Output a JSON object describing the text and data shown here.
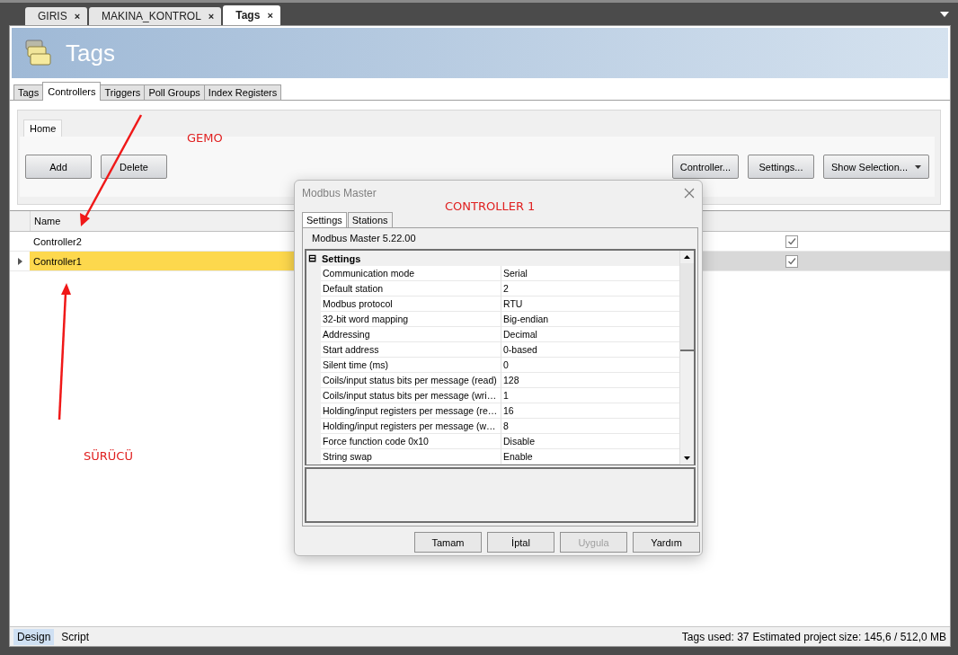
{
  "document_tabs": [
    {
      "label": "GIRIS",
      "selected": false,
      "close": "×"
    },
    {
      "label": "MAKINA_KONTROL",
      "selected": false,
      "close": "×"
    },
    {
      "label": "Tags",
      "selected": true,
      "close": "×"
    }
  ],
  "header": {
    "title": "Tags"
  },
  "tabs": [
    {
      "label": "Tags",
      "selected": false
    },
    {
      "label": "Controllers",
      "selected": true
    },
    {
      "label": "Triggers",
      "selected": false
    },
    {
      "label": "Poll Groups",
      "selected": false
    },
    {
      "label": "Index Registers",
      "selected": false
    }
  ],
  "ribbon": {
    "tab": "Home",
    "left_buttons": [
      "Add",
      "Delete"
    ],
    "right_buttons": [
      {
        "label": "Controller...",
        "kind": "plain"
      },
      {
        "label": "Settings...",
        "kind": "plain"
      },
      {
        "label": "Show Selection...",
        "kind": "dropdown"
      }
    ]
  },
  "grid": {
    "columns": [
      "Name"
    ],
    "rows": [
      {
        "name": "Controller2",
        "checked": true,
        "selected": false
      },
      {
        "name": "Controller1",
        "checked": true,
        "selected": true
      }
    ]
  },
  "status_bar": {
    "views": [
      {
        "label": "Design",
        "selected": true
      },
      {
        "label": "Script",
        "selected": false
      }
    ],
    "tags_used": "Tags used: 37",
    "project_size": "Estimated project size: 145,6 / 512,0 MB"
  },
  "dialog": {
    "title": "Modbus Master",
    "tabs": [
      {
        "label": "Settings",
        "selected": true
      },
      {
        "label": "Stations",
        "selected": false
      }
    ],
    "version": "Modbus Master 5.22.00",
    "category": {
      "label": "Settings",
      "expanded": true,
      "toggle": "⊟"
    },
    "properties": [
      {
        "name": "Communication mode",
        "value": "Serial"
      },
      {
        "name": "Default station",
        "value": "2"
      },
      {
        "name": "Modbus protocol",
        "value": "RTU"
      },
      {
        "name": "32-bit word mapping",
        "value": "Big-endian"
      },
      {
        "name": "Addressing",
        "value": "Decimal"
      },
      {
        "name": "Start address",
        "value": "0-based"
      },
      {
        "name": "Silent time (ms)",
        "value": "0"
      },
      {
        "name": "Coils/input status bits per message (read)",
        "value": "128"
      },
      {
        "name": "Coils/input status bits per message (wri…",
        "value": "1"
      },
      {
        "name": "Holding/input registers per message (re…",
        "value": "16"
      },
      {
        "name": "Holding/input registers per message (w…",
        "value": "8"
      },
      {
        "name": "Force function code 0x10",
        "value": "Disable"
      },
      {
        "name": "String swap",
        "value": "Enable"
      }
    ],
    "buttons": [
      {
        "label": "Tamam",
        "disabled": false
      },
      {
        "label": "İptal",
        "disabled": false
      },
      {
        "label": "Uygula",
        "disabled": true
      },
      {
        "label": "Yardım",
        "disabled": false
      }
    ]
  },
  "annotations": [
    "GEMO",
    "CONTROLLER 1",
    "SÜRÜCÜ"
  ]
}
